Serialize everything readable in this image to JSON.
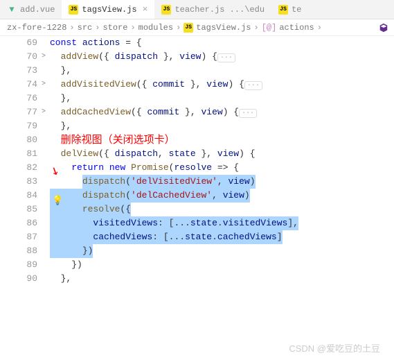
{
  "tabs": [
    {
      "icon": "vue",
      "label": "add.vue",
      "active": false
    },
    {
      "icon": "js",
      "label": "tagsView.js",
      "active": true,
      "closable": true
    },
    {
      "icon": "js",
      "label": "teacher.js ...\\edu",
      "active": false
    },
    {
      "icon": "js",
      "label": "te",
      "active": false
    }
  ],
  "breadcrumbs": {
    "items": [
      "zx-fore-1228",
      "src",
      "store",
      "modules"
    ],
    "file": "tagsView.js",
    "symbol": "actions",
    "symbol_type": "[@]"
  },
  "code": {
    "lines": [
      {
        "num": 69,
        "fold": "",
        "html": "<span class='kw'>const</span> <span class='prop'>actions</span> <span class='punct'>= {</span>"
      },
      {
        "num": 70,
        "fold": ">",
        "html": "  <span class='fn'>addView</span><span class='punct'>({ </span><span class='prop'>dispatch</span><span class='punct'> }, </span><span class='prop'>view</span><span class='punct'>) {</span><span class='fold-dots'>···</span>"
      },
      {
        "num": 73,
        "fold": "",
        "html": "  <span class='punct'>},</span>"
      },
      {
        "num": 74,
        "fold": ">",
        "html": "  <span class='fn'>addVisitedView</span><span class='punct'>({ </span><span class='prop'>commit</span><span class='punct'> }, </span><span class='prop'>view</span><span class='punct'>) {</span><span class='fold-dots'>···</span>"
      },
      {
        "num": 76,
        "fold": "",
        "html": "  <span class='punct'>},</span>"
      },
      {
        "num": 77,
        "fold": ">",
        "html": "  <span class='fn'>addCachedView</span><span class='punct'>({ </span><span class='prop'>commit</span><span class='punct'> }, </span><span class='prop'>view</span><span class='punct'>) {</span><span class='fold-dots'>···</span>"
      },
      {
        "num": 79,
        "fold": "",
        "html": "  <span class='punct'>},</span>"
      },
      {
        "num": 80,
        "fold": "",
        "html": "  <span class='annotation'>删除视图（关闭选项卡）</span>"
      },
      {
        "num": 81,
        "fold": "",
        "html": "  <span class='fn'>delView</span><span class='punct'>({ </span><span class='prop'>dispatch</span><span class='punct'>, </span><span class='prop'>state</span><span class='punct'> }, </span><span class='prop'>view</span><span class='punct'>) {</span>"
      },
      {
        "num": 82,
        "fold": "",
        "html": "    <span class='kw2'>return</span> <span class='kw'>new</span> <span class='fn'>Promise</span><span class='punct'>(</span><span class='prop'>resolve</span><span class='punct'> =&gt; {</span>"
      },
      {
        "num": 83,
        "fold": "",
        "html": "      <span class='highlight'><span class='fn'>dispatch</span><span class='punct'>(</span><span class='str'>'delVisitedView'</span><span class='punct'>, </span><span class='prop'>view</span><span class='punct'>)</span></span>"
      },
      {
        "num": 84,
        "fold": "",
        "html": "<span class='highlight'>      <span class='fn'>dispatch</span><span class='punct'>(</span><span class='str'>'delCachedView'</span><span class='punct'>, </span><span class='prop'>view</span><span class='punct'>)</span></span>"
      },
      {
        "num": 85,
        "fold": "",
        "html": "<span class='highlight'>      <span class='fn'>resolve</span><span class='punct'>({</span></span>"
      },
      {
        "num": 86,
        "fold": "",
        "html": "<span class='highlight'>        <span class='prop'>visitedViews</span><span class='punct'>: [...</span><span class='prop'>state</span><span class='punct'>.</span><span class='prop'>visitedViews</span><span class='punct'>],</span></span>"
      },
      {
        "num": 87,
        "fold": "",
        "html": "<span class='highlight'>        <span class='prop'>cachedViews</span><span class='punct'>: [...</span><span class='prop'>state</span><span class='punct'>.</span><span class='prop'>cachedViews</span><span class='punct'>]</span></span>"
      },
      {
        "num": 88,
        "fold": "",
        "html": "<span class='highlight'>      <span class='punct'>})</span></span>"
      },
      {
        "num": 89,
        "fold": "",
        "html": "    <span class='punct'>})</span>"
      },
      {
        "num": 90,
        "fold": "",
        "html": "  <span class='punct'>},</span>"
      }
    ]
  },
  "watermark": "CSDN @爱吃豆的土豆"
}
